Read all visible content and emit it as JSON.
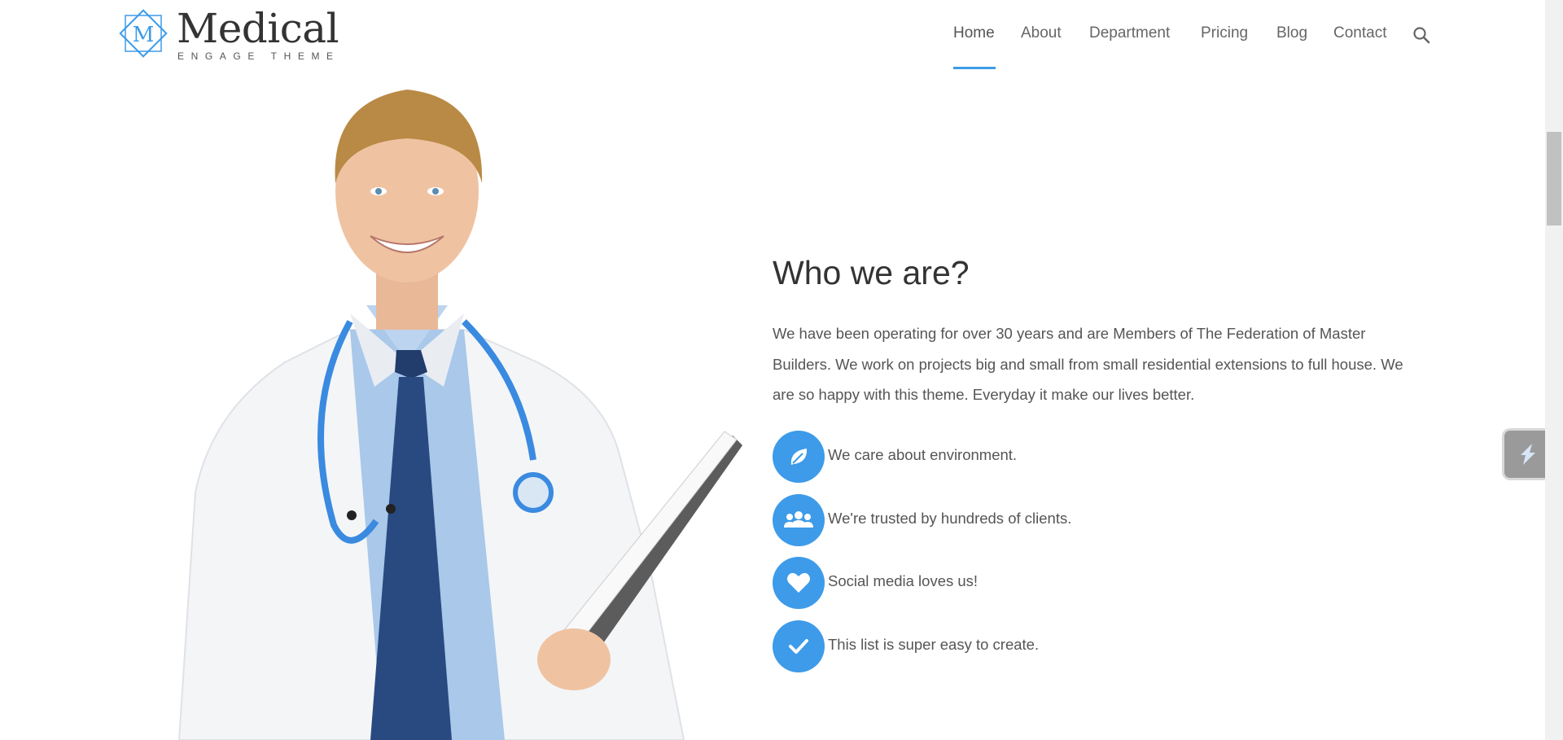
{
  "logo": {
    "mark_letter": "M",
    "title": "Medical",
    "tagline": "ENGAGE THEME"
  },
  "nav": {
    "items": [
      {
        "label": "Home",
        "active": true
      },
      {
        "label": "About"
      },
      {
        "label": "Department"
      },
      {
        "label": "Pricing"
      },
      {
        "label": "Blog"
      },
      {
        "label": "Contact"
      }
    ]
  },
  "main": {
    "heading": "Who we are?",
    "intro": "We have been operating for over 30 years and are Members of The Federation of Master Builders. We work on projects big and small from small residential extensions to full house. We are so happy with this theme. Everyday it make our lives better.",
    "features": [
      {
        "icon": "leaf-icon",
        "text": "We care about environment."
      },
      {
        "icon": "users-icon",
        "text": "We're trusted by hundreds of clients."
      },
      {
        "icon": "heart-icon",
        "text": "Social media loves us!"
      },
      {
        "icon": "check-icon",
        "text": "This list is super easy to create."
      }
    ]
  },
  "colors": {
    "accent": "#3d9be9",
    "text": "#555555",
    "heading": "#333333"
  }
}
